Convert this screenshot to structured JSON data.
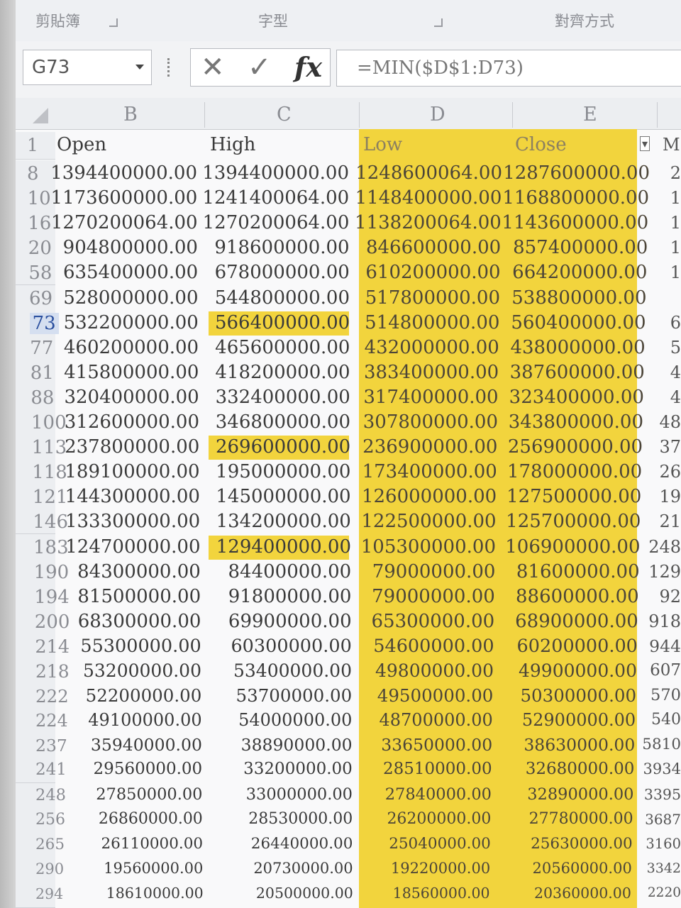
{
  "ribbon": {
    "groups": [
      "剪貼簿",
      "字型",
      "對齊方式"
    ]
  },
  "formula_bar": {
    "name_box": "G73",
    "cancel_icon": "✕",
    "enter_icon": "✓",
    "fx_label": "fx",
    "formula": "=MIN($D$1:D73)"
  },
  "columns": [
    "B",
    "C",
    "D",
    "E"
  ],
  "header_row": {
    "row": "1",
    "B": "Open",
    "C": "High",
    "D": "Low",
    "E": "Close",
    "F": "M"
  },
  "active_row": "73",
  "rows": [
    {
      "row": "8",
      "B": "1394400000.00",
      "C": "1394400000.00",
      "D": "1248600064.00",
      "E": "1287600000.00",
      "F": "2"
    },
    {
      "row": "10",
      "B": "1173600000.00",
      "C": "1241400064.00",
      "D": "1148400000.00",
      "E": "1168800000.00",
      "F": "1"
    },
    {
      "row": "16",
      "B": "1270200064.00",
      "C": "1270200064.00",
      "D": "1138200064.00",
      "E": "1143600000.00",
      "F": "1"
    },
    {
      "row": "20",
      "B": "904800000.00",
      "C": "918600000.00",
      "D": "846600000.00",
      "E": "857400000.00",
      "F": "1"
    },
    {
      "row": "58",
      "B": "635400000.00",
      "C": "678000000.00",
      "D": "610200000.00",
      "E": "664200000.00",
      "F": "1"
    },
    {
      "row": "69",
      "B": "528000000.00",
      "C": "544800000.00",
      "D": "517800000.00",
      "E": "538800000.00",
      "F": ""
    },
    {
      "row": "73",
      "B": "532200000.00",
      "C": "566400000.00",
      "D": "514800000.00",
      "E": "560400000.00",
      "F": "6"
    },
    {
      "row": "77",
      "B": "460200000.00",
      "C": "465600000.00",
      "D": "432000000.00",
      "E": "438000000.00",
      "F": "5"
    },
    {
      "row": "81",
      "B": "415800000.00",
      "C": "418200000.00",
      "D": "383400000.00",
      "E": "387600000.00",
      "F": "4"
    },
    {
      "row": "88",
      "B": "320400000.00",
      "C": "332400000.00",
      "D": "317400000.00",
      "E": "323400000.00",
      "F": "4"
    },
    {
      "row": "100",
      "B": "312600000.00",
      "C": "346800000.00",
      "D": "307800000.00",
      "E": "343800000.00",
      "F": "48"
    },
    {
      "row": "113",
      "B": "237800000.00",
      "C": "269600000.00",
      "D": "236900000.00",
      "E": "256900000.00",
      "F": "37"
    },
    {
      "row": "118",
      "B": "189100000.00",
      "C": "195000000.00",
      "D": "173400000.00",
      "E": "178000000.00",
      "F": "26"
    },
    {
      "row": "121",
      "B": "144300000.00",
      "C": "145000000.00",
      "D": "126000000.00",
      "E": "127500000.00",
      "F": "19"
    },
    {
      "row": "146",
      "B": "133300000.00",
      "C": "134200000.00",
      "D": "122500000.00",
      "E": "125700000.00",
      "F": "21"
    },
    {
      "row": "183",
      "B": "124700000.00",
      "C": "129400000.00",
      "D": "105300000.00",
      "E": "106900000.00",
      "F": "248"
    },
    {
      "row": "190",
      "B": "84300000.00",
      "C": "84400000.00",
      "D": "79000000.00",
      "E": "81600000.00",
      "F": "129"
    },
    {
      "row": "194",
      "B": "81500000.00",
      "C": "91800000.00",
      "D": "79000000.00",
      "E": "88600000.00",
      "F": "92"
    },
    {
      "row": "200",
      "B": "68300000.00",
      "C": "69900000.00",
      "D": "65300000.00",
      "E": "68900000.00",
      "F": "918"
    },
    {
      "row": "214",
      "B": "55300000.00",
      "C": "60300000.00",
      "D": "54600000.00",
      "E": "60200000.00",
      "F": "944"
    },
    {
      "row": "218",
      "B": "53200000.00",
      "C": "53400000.00",
      "D": "49800000.00",
      "E": "49900000.00",
      "F": "607"
    },
    {
      "row": "222",
      "B": "52200000.00",
      "C": "53700000.00",
      "D": "49500000.00",
      "E": "50300000.00",
      "F": "570"
    },
    {
      "row": "224",
      "B": "49100000.00",
      "C": "54000000.00",
      "D": "48700000.00",
      "E": "52900000.00",
      "F": "540"
    },
    {
      "row": "237",
      "B": "35940000.00",
      "C": "38890000.00",
      "D": "33650000.00",
      "E": "38630000.00",
      "F": "5810"
    },
    {
      "row": "241",
      "B": "29560000.00",
      "C": "33200000.00",
      "D": "28510000.00",
      "E": "32680000.00",
      "F": "3934"
    },
    {
      "row": "248",
      "B": "27850000.00",
      "C": "33000000.00",
      "D": "27840000.00",
      "E": "32890000.00",
      "F": "3395"
    },
    {
      "row": "256",
      "B": "26860000.00",
      "C": "28530000.00",
      "D": "26200000.00",
      "E": "27780000.00",
      "F": "3687"
    },
    {
      "row": "265",
      "B": "26110000.00",
      "C": "26440000.00",
      "D": "25040000.00",
      "E": "25630000.00",
      "F": "3160"
    },
    {
      "row": "290",
      "B": "19560000.00",
      "C": "20730000.00",
      "D": "19220000.00",
      "E": "20560000.00",
      "F": "3342"
    },
    {
      "row": "294",
      "B": "18610000.00",
      "C": "20500000.00",
      "D": "18560000.00",
      "E": "20360000.00",
      "F": "2220"
    }
  ],
  "highlighted_high_rows": [
    "73",
    "113",
    "183"
  ],
  "colors": {
    "highlight": "#f2d43d"
  }
}
